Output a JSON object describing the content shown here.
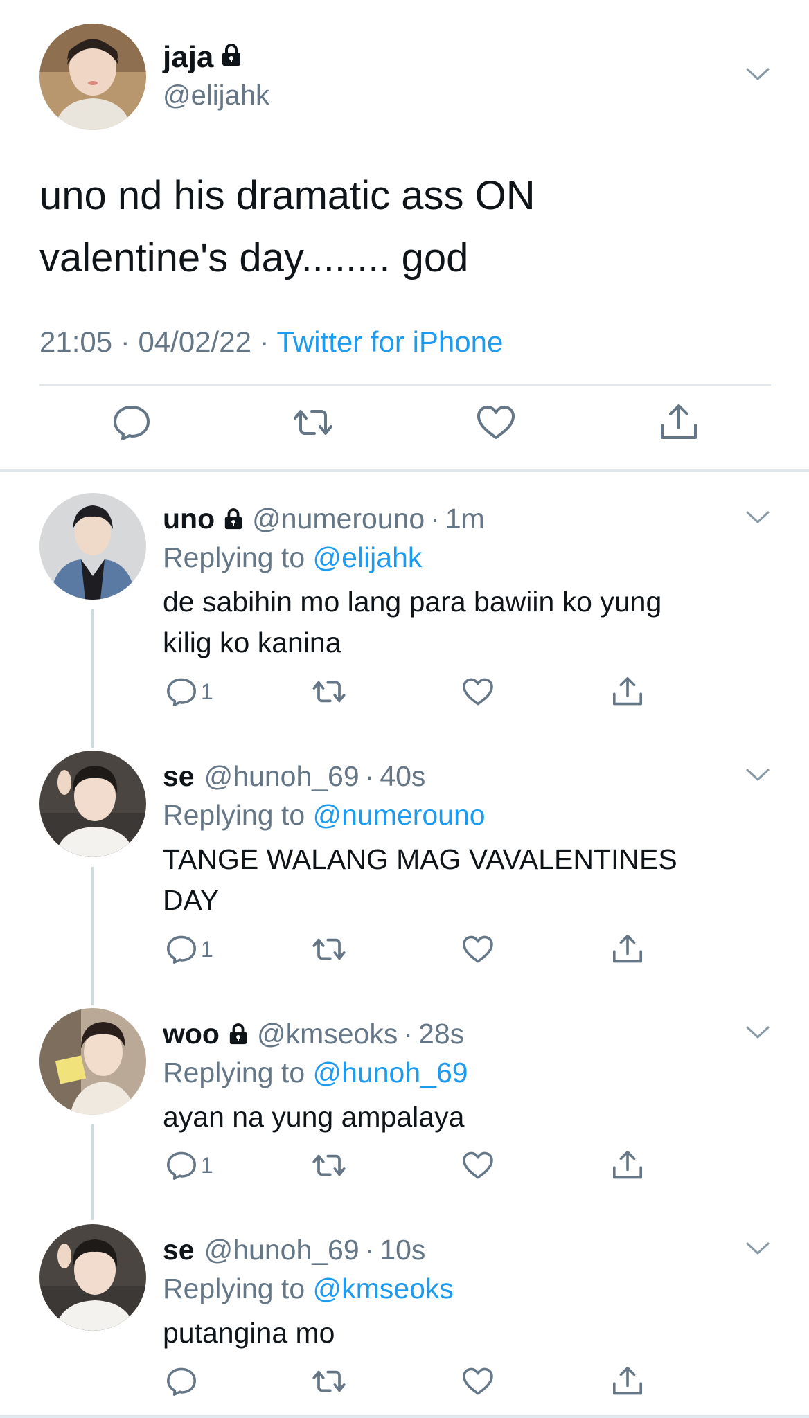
{
  "colors": {
    "accent": "#1d9bf0",
    "muted": "#657786",
    "divider": "#e1e8ed",
    "thread": "#cfd9de"
  },
  "main_tweet": {
    "display_name": "jaja",
    "handle": "@elijahk",
    "text_line1": "uno nd his dramatic ass ON",
    "text_line2": "valentine's day........ god",
    "time": "21:05",
    "date": "04/02/22",
    "separator": "·",
    "source": "Twitter for iPhone",
    "icons": [
      "lock-icon",
      "chevron-down-icon",
      "reply-icon",
      "retweet-icon",
      "like-icon",
      "share-icon"
    ]
  },
  "replies": [
    {
      "display_name": "uno",
      "locked": true,
      "handle": "@numerouno",
      "time": "1m",
      "replying_label": "Replying to",
      "replying_to": "@elijahk",
      "text_line1": "de sabihin mo lang para bawiin ko yung",
      "text_line2": "kilig ko kanina",
      "reply_count": "1"
    },
    {
      "display_name": "se",
      "locked": false,
      "handle": "@hunoh_69",
      "time": "40s",
      "replying_label": "Replying to",
      "replying_to": "@numerouno",
      "text_line1": "TANGE WALANG MAG VAVALENTINES",
      "text_line2": "DAY",
      "reply_count": "1"
    },
    {
      "display_name": "woo",
      "locked": true,
      "handle": "@kmseoks",
      "time": "28s",
      "replying_label": "Replying to",
      "replying_to": "@hunoh_69",
      "text_line1": "ayan na yung ampalaya",
      "text_line2": "",
      "reply_count": "1"
    },
    {
      "display_name": "se",
      "locked": false,
      "handle": "@hunoh_69",
      "time": "10s",
      "replying_label": "Replying to",
      "replying_to": "@kmseoks",
      "text_line1": "putangina mo",
      "text_line2": "",
      "reply_count": ""
    }
  ]
}
